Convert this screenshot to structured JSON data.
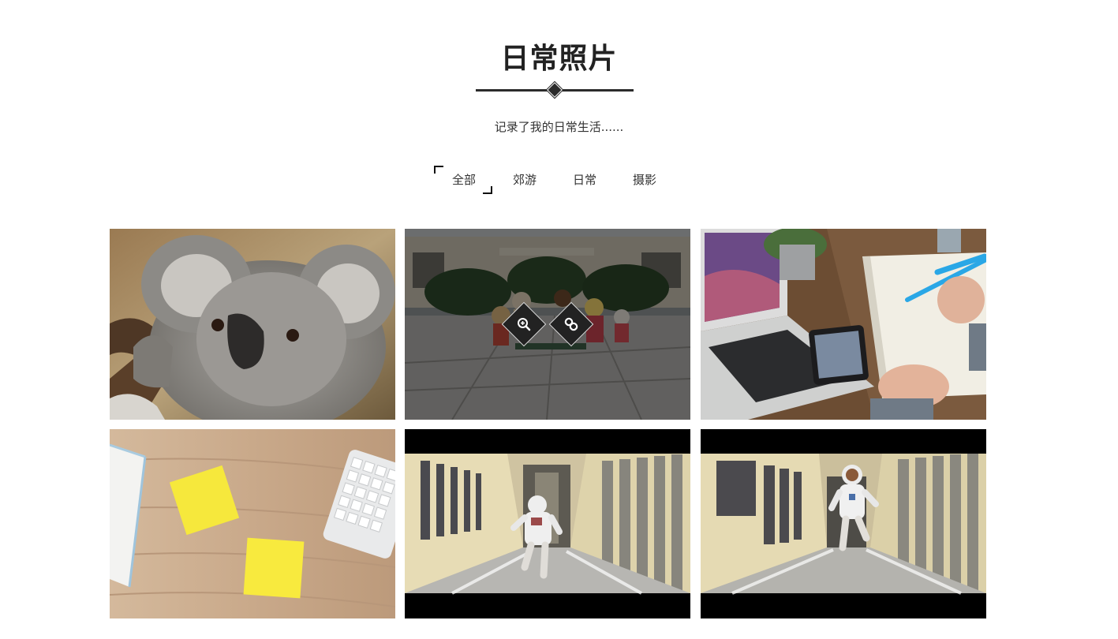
{
  "header": {
    "title": "日常照片",
    "subtitle": "记录了我的日常生活......"
  },
  "filters": [
    {
      "label": "全部",
      "active": true
    },
    {
      "label": "郊游",
      "active": false
    },
    {
      "label": "日常",
      "active": false
    },
    {
      "label": "摄影",
      "active": false
    }
  ],
  "gallery": {
    "hover_actions": [
      "zoom-in-icon",
      "link-icon"
    ]
  }
}
